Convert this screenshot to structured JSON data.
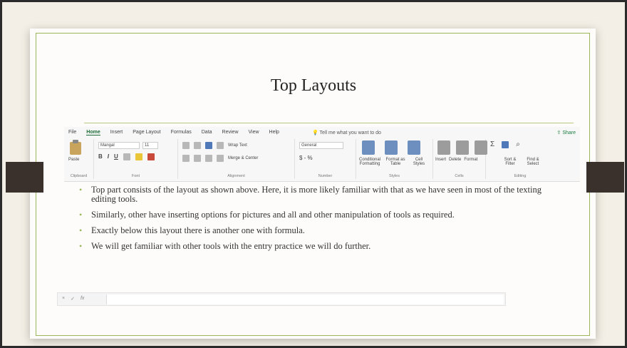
{
  "slide": {
    "title": "Top Layouts",
    "accent_color": "#9ab85a",
    "bullets": [
      "Top part consists of the layout as shown above. Here, it is more likely familiar with that as we have seen in most of the texting editing tools.",
      "Similarly, other have inserting options for pictures and all and other manipulation of tools as required.",
      "Exactly below this layout there is another one with formula.",
      "We will get familiar with other tools with the entry practice we will do further."
    ]
  },
  "ribbon": {
    "menu": [
      "File",
      "Home",
      "Insert",
      "Page Layout",
      "Formulas",
      "Data",
      "Review",
      "View",
      "Help"
    ],
    "tell_me": "Tell me what you want to do",
    "share": "Share",
    "clipboard": {
      "paste": "Paste",
      "label": "Clipboard"
    },
    "font": {
      "name": "Mangal",
      "size": "11",
      "label": "Font"
    },
    "alignment": {
      "wrap": "Wrap Text",
      "merge": "Merge & Center",
      "label": "Alignment"
    },
    "number": {
      "format": "General",
      "currency": "$ - %",
      "label": "Number"
    },
    "styles": {
      "conditional": "Conditional Formatting",
      "format_table": "Format as Table",
      "cell_styles": "Cell Styles",
      "label": "Styles"
    },
    "cells": {
      "insert": "Insert",
      "delete": "Delete",
      "format": "Format",
      "label": "Cells"
    },
    "editing": {
      "sort": "Sort & Filter",
      "find": "Find & Select",
      "label": "Editing"
    }
  },
  "formula_bar": {
    "cancel": "×",
    "enter": "✓",
    "fx": "fx"
  }
}
